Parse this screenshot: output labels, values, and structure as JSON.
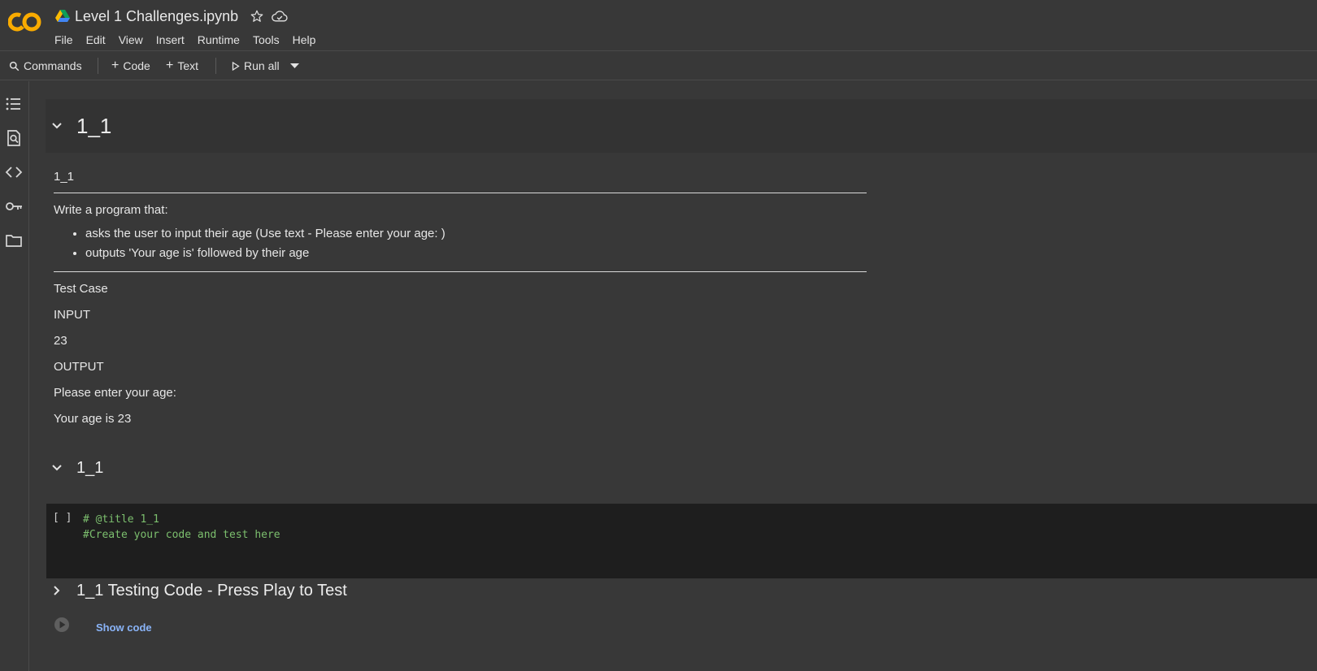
{
  "header": {
    "title": "Level 1 Challenges.ipynb",
    "logo_text": "CO",
    "menu": [
      "File",
      "Edit",
      "View",
      "Insert",
      "Runtime",
      "Tools",
      "Help"
    ]
  },
  "toolbar": {
    "commands_label": "Commands",
    "code_label": "Code",
    "text_label": "Text",
    "run_all_label": "Run all"
  },
  "rail_icons": [
    "toc-icon",
    "find-icon",
    "code-snippets-icon",
    "secrets-key-icon",
    "files-folder-icon"
  ],
  "notebook": {
    "section1_title": "1_1",
    "text_cell": {
      "heading": "1_1",
      "intro": "Write a program that:",
      "bullets": [
        "asks the user to input their age (Use text - Please enter your age: )",
        "outputs 'Your age is' followed by their age"
      ],
      "test_case": "Test Case",
      "input_label": "INPUT",
      "input_value": "23",
      "output_label": "OUTPUT",
      "output_line1": "Please enter your age:",
      "output_line2": "Your age is 23"
    },
    "section2_title": "1_1",
    "code_cell": {
      "run_indicator": "[ ]",
      "line1": "# @title 1_1",
      "line2": "#Create your code and test here"
    },
    "section3_title": "1_1 Testing Code - Press Play to Test",
    "show_code_label": "Show code"
  },
  "colors": {
    "background": "#383838",
    "code_bg": "#1e1e1e",
    "comment_green": "#7cbf6e",
    "link_blue": "#8ab4f8",
    "logo_orange": "#f9ab00"
  }
}
